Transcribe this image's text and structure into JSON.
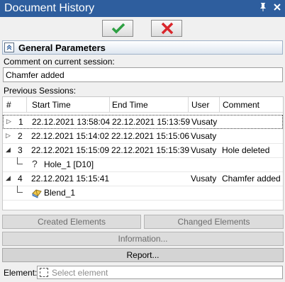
{
  "window": {
    "title": "Document History",
    "pin_icon": "pin-icon",
    "close_icon": "close-icon"
  },
  "dialog_buttons": {
    "ok_icon": "checkmark-icon",
    "cancel_icon": "x-icon"
  },
  "general_parameters": {
    "header": "General Parameters",
    "comment_label": "Comment on current session:",
    "comment_value": "Chamfer added",
    "previous_sessions_label": "Previous Sessions:"
  },
  "sessions_table": {
    "columns": [
      "#",
      "Start Time",
      "End Time",
      "User",
      "Comment"
    ],
    "rows": [
      {
        "num": "1",
        "start": "22.12.2021 13:58:04",
        "end": "22.12.2021 15:13:59",
        "user": "Vusaty",
        "comment": "",
        "expanded": false
      },
      {
        "num": "2",
        "start": "22.12.2021 15:14:02",
        "end": "22.12.2021 15:15:06",
        "user": "Vusaty",
        "comment": "",
        "expanded": false
      },
      {
        "num": "3",
        "start": "22.12.2021 15:15:09",
        "end": "22.12.2021 15:15:39",
        "user": "Vusaty",
        "comment": "Hole deleted",
        "expanded": true
      },
      {
        "child": "Hole_1 [D10]"
      },
      {
        "num": "4",
        "start": "22.12.2021 15:15:41",
        "end": "",
        "user": "Vusaty",
        "comment": "Chamfer added",
        "expanded": true
      },
      {
        "child": "Blend_1"
      }
    ]
  },
  "buttons": {
    "created_elements": "Created Elements",
    "changed_elements": "Changed Elements",
    "information": "Information...",
    "report": "Report..."
  },
  "element": {
    "label": "Element:",
    "placeholder": "Select element"
  },
  "colors": {
    "titlebar": "#2e5e9e",
    "ok_green": "#2ea043",
    "cancel_red": "#d9262b"
  }
}
